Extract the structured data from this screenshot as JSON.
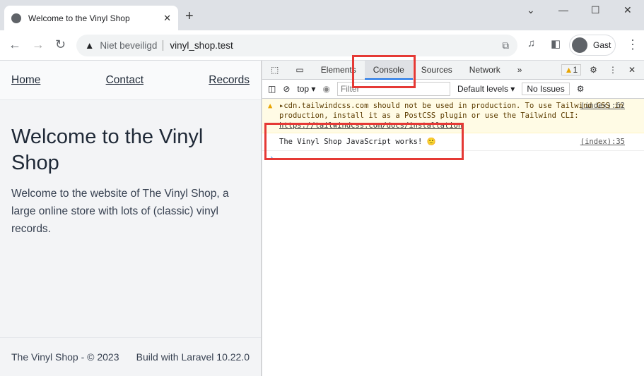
{
  "browser": {
    "tab_title": "Welcome to the Vinyl Shop",
    "security": "Niet beveiligd",
    "url": "vinyl_shop.test",
    "profile": "Gast"
  },
  "site": {
    "nav": [
      "Home",
      "Contact",
      "Records"
    ],
    "title": "Welcome to the Vinyl Shop",
    "intro": "Welcome to the website of The Vinyl Shop, a large online store with lots of (classic) vinyl records.",
    "footer_left": "The Vinyl Shop - © 2023",
    "footer_right": "Build with Laravel 10.22.0"
  },
  "devtools": {
    "tabs": [
      "Elements",
      "Console",
      "Sources",
      "Network"
    ],
    "active_tab": "Console",
    "warning_count": "1",
    "context": "top",
    "filter_placeholder": "Filter",
    "levels": "Default levels ▾",
    "issues": "No Issues",
    "messages": [
      {
        "type": "warning",
        "text": "▸cdn.tailwindcss.com should not be used in production. To use Tailwind CSS in production, install it as a PostCSS plugin or use the Tailwind CLI: ",
        "link": "https://tailwindcss.com/docs/installation",
        "source": "(index):62"
      },
      {
        "type": "log",
        "text": "The Vinyl Shop JavaScript works! 🙂",
        "source": "(index):35"
      }
    ],
    "prompt": "›"
  },
  "highlight_color": "#e53935"
}
